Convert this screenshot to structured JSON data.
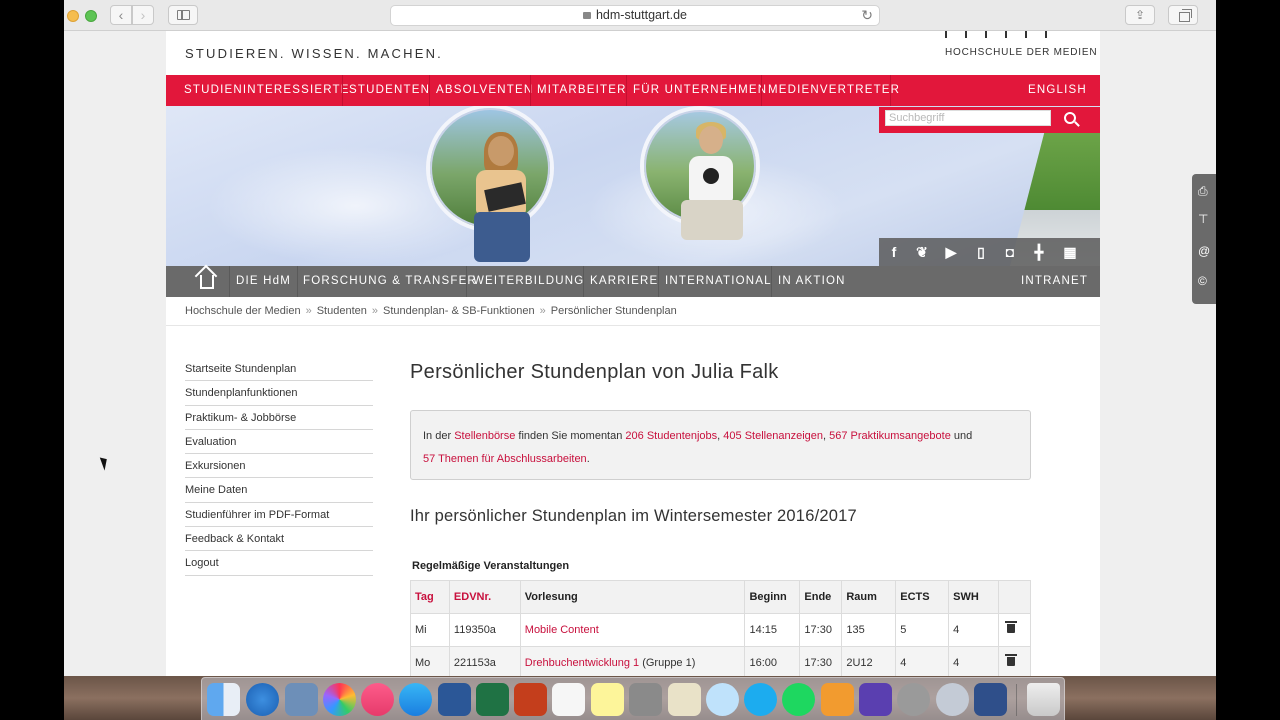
{
  "browser": {
    "url": "hdm-stuttgart.de"
  },
  "site": {
    "tagline": "STUDIEREN. WISSEN. MACHEN.",
    "logo_text": "HOCHSCHULE DER MEDIEN"
  },
  "topnav": {
    "items": [
      "STUDIENINTERESSIERTE",
      "STUDENTEN",
      "ABSOLVENTEN",
      "MITARBEITER",
      "FÜR UNTERNEHMEN",
      "MEDIENVERTRETER"
    ],
    "english": "ENGLISH"
  },
  "search": {
    "placeholder": "Suchbegriff"
  },
  "social": [
    "facebook-icon",
    "twitter-icon",
    "youtube-icon",
    "mobile-icon",
    "shop-icon",
    "signpost-icon",
    "qr-icon"
  ],
  "mainnav": {
    "items": [
      "DIE HdM",
      "FORSCHUNG & TRANSFER",
      "WEITERBILDUNG",
      "KARRIERE",
      "INTERNATIONAL",
      "IN AKTION"
    ],
    "intranet": "INTRANET"
  },
  "breadcrumb": [
    "Hochschule der Medien",
    "Studenten",
    "Stundenplan- & SB-Funktionen",
    "Persönlicher Stundenplan"
  ],
  "breadcrumb_sep": "»",
  "leftnav": [
    "Startseite Stundenplan",
    "Stundenplanfunktionen",
    "Praktikum- & Jobbörse",
    "Evaluation",
    "Exkursionen",
    "Meine Daten",
    "Studienführer im PDF-Format",
    "Feedback & Kontakt",
    "Logout"
  ],
  "content": {
    "title": "Persönlicher Stundenplan von Julia Falk",
    "notice": {
      "t1": "In der ",
      "link_stellenboerse": "Stellenbörse",
      "t2": " finden Sie momentan ",
      "link_jobs": "206 Studentenjobs",
      "t3": ", ",
      "link_anzeigen": "405 Stellenanzeigen",
      "t4": ", ",
      "link_praktikum": "567 Praktikumsangebote",
      "t5": " und",
      "link_themen": "57 Themen für Abschlussarbeiten",
      "t6": "."
    },
    "subtitle": "Ihr persönlicher Stundenplan im Wintersemester 2016/2017",
    "table_caption": "Regelmäßige Veranstaltungen",
    "table_headers": [
      "Tag",
      "EDVNr.",
      "Vorlesung",
      "Beginn",
      "Ende",
      "Raum",
      "ECTS",
      "SWH"
    ],
    "rows": [
      {
        "tag": "Mi",
        "edvnr": "119350a",
        "vorlesung": "Mobile Content",
        "gruppe": "",
        "beginn": "14:15",
        "ende": "17:30",
        "raum": "135",
        "ects": "5",
        "swh": "4"
      },
      {
        "tag": "Mo",
        "edvnr": "221153a",
        "vorlesung": "Drehbuchentwicklung 1",
        "gruppe": " (Gruppe 1)",
        "beginn": "16:00",
        "ende": "17:30",
        "raum": "2U12",
        "ects": "4",
        "swh": "4"
      }
    ]
  },
  "colors": {
    "brand_red": "#e2173b",
    "link_red": "#c8103d",
    "nav_gray": "#6a6a6a"
  }
}
